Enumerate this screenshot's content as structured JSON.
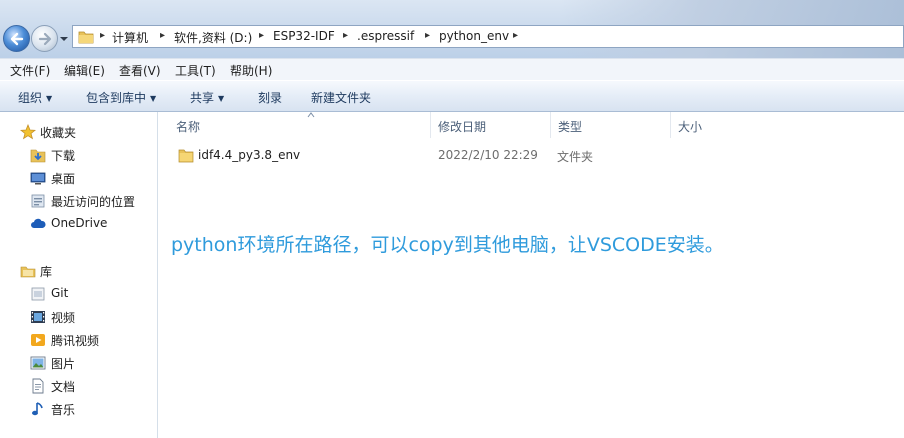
{
  "address_bar": {
    "crumbs": [
      "计算机",
      "软件,资料 (D:)",
      "ESP32-IDF",
      ".espressif",
      "python_env"
    ]
  },
  "menu": [
    "文件(F)",
    "编辑(E)",
    "查看(V)",
    "工具(T)",
    "帮助(H)"
  ],
  "toolbar": {
    "organize": "组织",
    "include_in_library": "包含到库中",
    "share": "共享",
    "burn": "刻录",
    "new_folder": "新建文件夹"
  },
  "sidebar": {
    "favorites": {
      "label": "收藏夹",
      "items": [
        "下载",
        "桌面",
        "最近访问的位置"
      ]
    },
    "onedrive": "OneDrive",
    "libraries": {
      "label": "库",
      "items": [
        "Git",
        "视频",
        "腾讯视频",
        "图片",
        "文档",
        "音乐"
      ]
    }
  },
  "columns": [
    "名称",
    "修改日期",
    "类型",
    "大小"
  ],
  "files": [
    {
      "name": "idf4.4_py3.8_env",
      "modified": "2022/2/10 22:29",
      "type": "文件夹",
      "size": ""
    }
  ],
  "annotation": "python环境所在路径，可以copy到其他电脑，让VSCODE安装。",
  "colors": {
    "annotation": "#2f9bdc",
    "folder": "#e8c25a",
    "toolbar_text": "#1e3a5f"
  }
}
